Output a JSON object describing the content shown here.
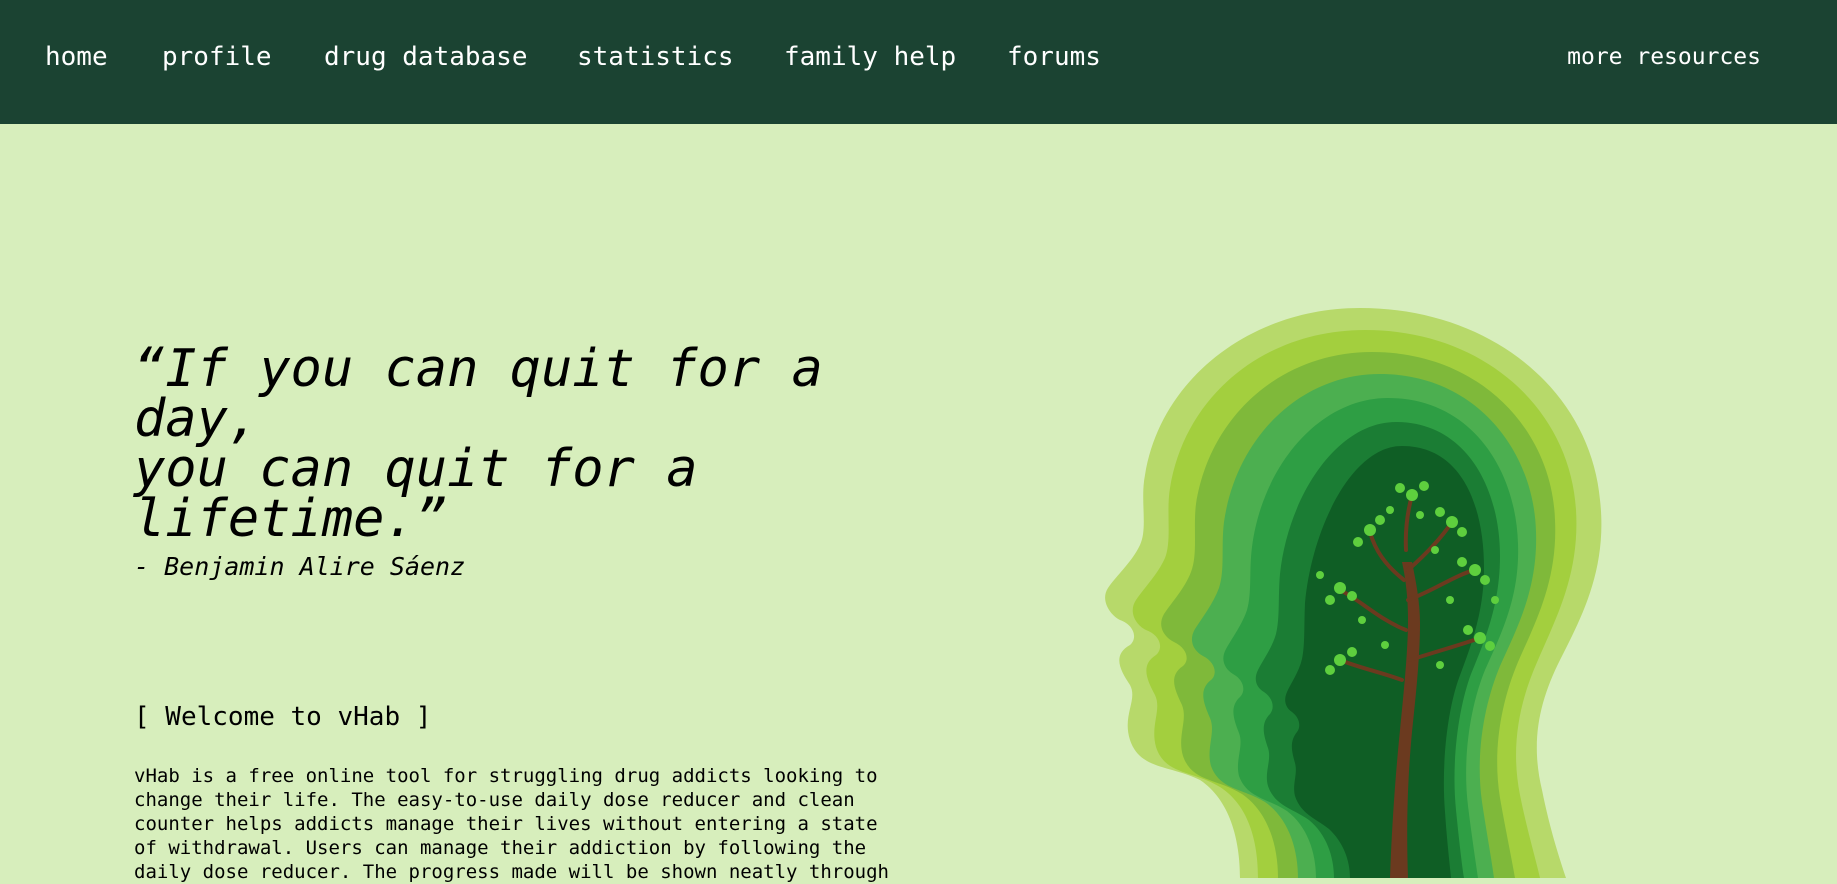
{
  "nav": {
    "items": [
      {
        "label": "home"
      },
      {
        "label": "profile"
      },
      {
        "label": "drug database"
      },
      {
        "label": "statistics"
      },
      {
        "label": "family help"
      },
      {
        "label": "forums"
      }
    ],
    "more_label": "more resources"
  },
  "hero": {
    "quote_line1": "“If you can quit for a day,",
    "quote_line2": "you can quit for a lifetime.”",
    "author": "- Benjamin Alire Sáenz",
    "welcome": "[ Welcome to vHab ]",
    "description": "vHab is a free online tool for struggling drug addicts looking to change their life. The easy-to-use daily dose reducer and clean counter helps addicts manage their lives without entering a state of withdrawal. Users can manage their addiction by following the daily dose reducer. The progress made will be shown neatly through"
  },
  "colors": {
    "nav_bg": "#1b4332",
    "page_bg": "#d7eebc",
    "nav_text": "#ffffff"
  }
}
